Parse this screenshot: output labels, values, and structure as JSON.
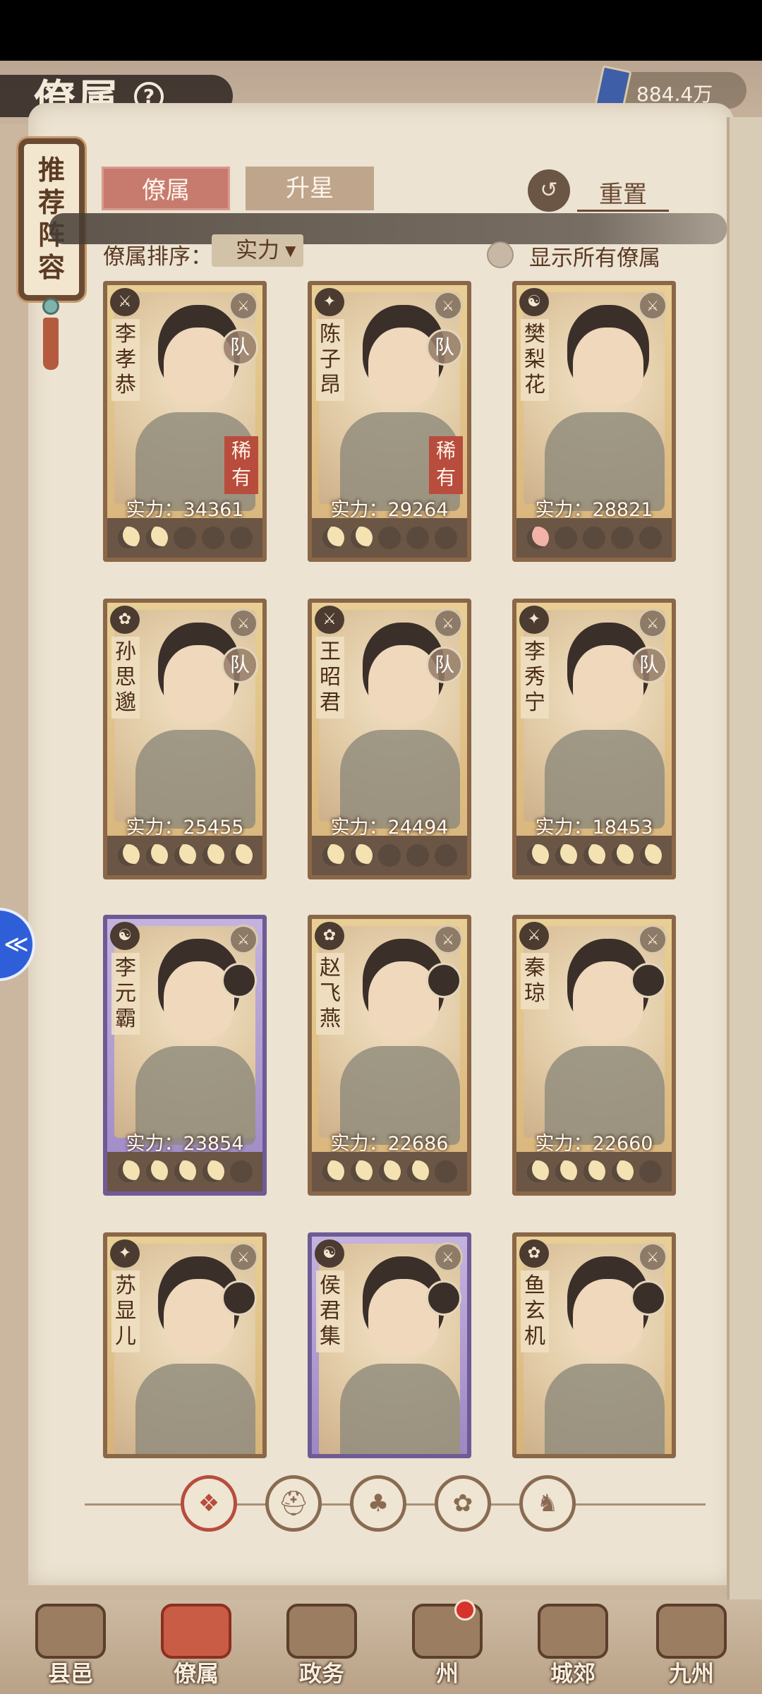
{
  "header": {
    "title": "僚属",
    "help_icon": "?",
    "currency_value": "884.4万"
  },
  "side_banner": {
    "chars": [
      "推",
      "荐",
      "阵",
      "容"
    ]
  },
  "tabs": [
    {
      "label": "僚属",
      "active": true
    },
    {
      "label": "升星",
      "active": false
    }
  ],
  "reset_label": "重置",
  "sort": {
    "label": "僚属排序：",
    "value": "实力"
  },
  "show_all_label": "显示所有僚属",
  "cards": [
    {
      "name": [
        "李",
        "孝",
        "恭"
      ],
      "power": "实力：34361",
      "team_tag": "队",
      "rarity": [
        "稀",
        "有"
      ],
      "moons": [
        "on",
        "on",
        "off",
        "off",
        "off"
      ],
      "frame": "gold"
    },
    {
      "name": [
        "陈",
        "子",
        "昂"
      ],
      "power": "实力：29264",
      "team_tag": "队",
      "rarity": [
        "稀",
        "有"
      ],
      "moons": [
        "on",
        "on",
        "off",
        "off",
        "off"
      ],
      "frame": "gold"
    },
    {
      "name": [
        "樊",
        "梨",
        "花"
      ],
      "power": "实力：28821",
      "moons": [
        "red",
        "off",
        "off",
        "off",
        "off"
      ],
      "frame": "gold"
    },
    {
      "name": [
        "孙",
        "思",
        "邈"
      ],
      "power": "实力：25455",
      "team_tag": "队",
      "moons": [
        "on",
        "on",
        "on",
        "on",
        "on"
      ],
      "frame": "gold"
    },
    {
      "name": [
        "王",
        "昭",
        "君"
      ],
      "power": "实力：24494",
      "team_tag": "队",
      "moons": [
        "on",
        "on",
        "off",
        "off",
        "off"
      ],
      "frame": "gold"
    },
    {
      "name": [
        "李",
        "秀",
        "宁"
      ],
      "power": "实力：18453",
      "team_tag": "队",
      "moons": [
        "on",
        "on",
        "on",
        "on",
        "on"
      ],
      "frame": "gold"
    },
    {
      "name": [
        "李",
        "元",
        "霸"
      ],
      "power": "实力：23854",
      "moons": [
        "on",
        "on",
        "on",
        "on",
        "off"
      ],
      "frame": "purple"
    },
    {
      "name": [
        "赵",
        "飞",
        "燕"
      ],
      "power": "实力：22686",
      "moons": [
        "on",
        "on",
        "on",
        "on",
        "off"
      ],
      "frame": "gold"
    },
    {
      "name": [
        "秦",
        "琼"
      ],
      "power": "实力：22660",
      "moons": [
        "on",
        "on",
        "on",
        "on",
        "off"
      ],
      "frame": "gold"
    },
    {
      "name": [
        "苏",
        "显",
        "儿"
      ],
      "power": "",
      "moons": [],
      "frame": "gold"
    },
    {
      "name": [
        "侯",
        "君",
        "集"
      ],
      "power": "",
      "moons": [],
      "frame": "purple"
    },
    {
      "name": [
        "鱼",
        "玄",
        "机"
      ],
      "power": "",
      "moons": [],
      "frame": "gold"
    }
  ],
  "filters": [
    {
      "icon": "diamond-flower-icon",
      "active": true
    },
    {
      "icon": "helmet-icon",
      "active": false
    },
    {
      "icon": "gourd-icon",
      "active": false
    },
    {
      "icon": "fan-icon",
      "active": false
    },
    {
      "icon": "horse-icon",
      "active": false
    }
  ],
  "nav": [
    {
      "label": "县邑",
      "active": false
    },
    {
      "label": "僚属",
      "active": true
    },
    {
      "label": "政务",
      "active": false
    },
    {
      "label": "州",
      "active": false,
      "badge": true
    },
    {
      "label": "城郊",
      "active": false
    },
    {
      "label": "九州",
      "active": false
    }
  ],
  "colors": {
    "accent_red": "#b84c3d",
    "tab_active": "#c77b6e",
    "paper": "#ece3d2",
    "ink": "#5b3a24"
  }
}
